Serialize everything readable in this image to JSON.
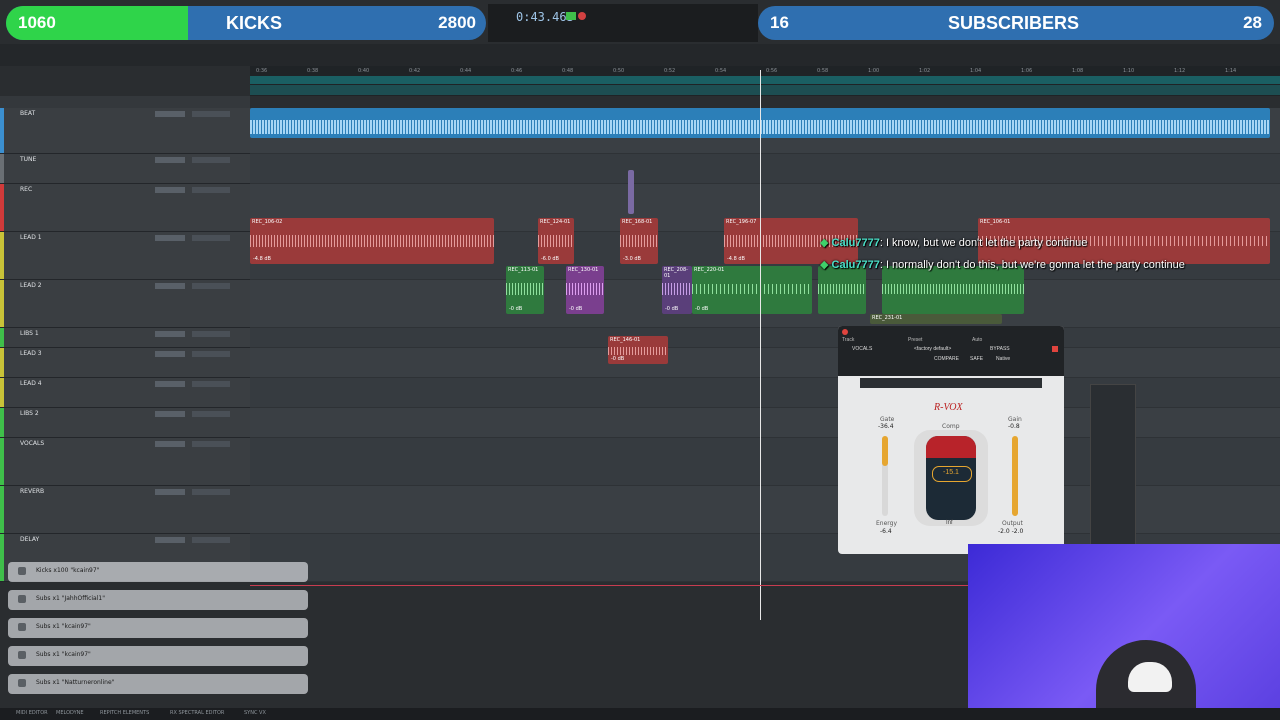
{
  "overlay": {
    "left_count": "1060",
    "left_label": "KICKS",
    "left_goal": "2800",
    "left_progress": 0.38,
    "right_count": "16",
    "right_label": "SUBSCRIBERS",
    "right_goal": "28",
    "right_progress": 0.0
  },
  "transport": {
    "counter": "0:43.463"
  },
  "tracks": [
    {
      "name": "BEAT",
      "color": "#3b8fd0"
    },
    {
      "name": "TUNE",
      "color": "#6a6f74"
    },
    {
      "name": "REC",
      "color": "#d03a3a"
    },
    {
      "name": "LEAD 1",
      "color": "#c8c238"
    },
    {
      "name": "LEAD 2",
      "color": "#c8c238"
    },
    {
      "name": "LIBS 1",
      "color": "#3fbf4a"
    },
    {
      "name": "LEAD 3",
      "color": "#c8c238"
    },
    {
      "name": "LEAD 4",
      "color": "#c8c238"
    },
    {
      "name": "LIBS 2",
      "color": "#3fbf4a"
    },
    {
      "name": "VOCALS",
      "color": "#3fbf4a"
    },
    {
      "name": "REVERB",
      "color": "#3fbf4a"
    },
    {
      "name": "DELAY",
      "color": "#3fbf4a"
    }
  ],
  "clips": {
    "lead1": [
      {
        "name": "REC_106-02",
        "db": "-4.8 dB"
      },
      {
        "name": "REC_124-01",
        "db": "-6.0 dB"
      },
      {
        "name": "REC_168-01",
        "db": "-3.0 dB"
      },
      {
        "name": "REC_196-07",
        "db": "-4.8 dB"
      },
      {
        "name": "REC_106-01",
        "db": ""
      }
    ],
    "lead2": [
      {
        "name": "REC_113-01",
        "db": "-0 dB"
      },
      {
        "name": "REC_130-01",
        "db": "-0 dB"
      },
      {
        "name": "REC_208-01",
        "db": "-0 dB"
      },
      {
        "name": "REC_220-01",
        "db": "-0 dB"
      },
      {
        "name": "REC_231-01",
        "db": ""
      }
    ],
    "lead3": [
      {
        "name": "REC_146-01",
        "db": "-0 dB"
      }
    ]
  },
  "chat": [
    {
      "user": "Calu7777",
      "text": ": I know, but we don't let the party continue"
    },
    {
      "user": "Calu7777",
      "text": ": I normally don't do this, but we're gonna let the party continue"
    }
  ],
  "plugin": {
    "title": "R-VOX",
    "gate_label": "Gate",
    "gate_value": "-36.4",
    "gain_label": "Gain",
    "gain_value": "-0.8",
    "comp_label": "Comp",
    "comp_value": "-15.1",
    "inf_label": "Inf",
    "energy_label": "Energy",
    "energy_value": "-6.4",
    "output_label": "Output",
    "output_values": "-2.0  -2.0",
    "track_label": "Track",
    "preset_label": "Preset",
    "auto_label": "Auto",
    "track_name": "VOCALS",
    "preset_name": "<factory default>",
    "bypass": "BYPASS",
    "compare": "COMPARE",
    "safe": "SAFE",
    "native": "Native"
  },
  "notifications": [
    "Kicks x100 \"kcain97\"",
    "Subs x1 \"JahhOfficial1\"",
    "Subs x1 \"kcain97\"",
    "Subs x1 \"kcain97\"",
    "Subs x1 \"Natturneronline\""
  ],
  "bottom_bar": [
    "MIDI EDITOR",
    "MELODYNE",
    "REPITCH ELEMENTS",
    "RX SPECTRAL EDITOR",
    "SYNC VX"
  ],
  "ruler_ticks": [
    "0:36",
    "0:38",
    "0:40",
    "0:42",
    "0:44",
    "0:46",
    "0:48",
    "0:50",
    "0:52",
    "0:54",
    "0:56",
    "0:58",
    "1:00",
    "1:02",
    "1:04",
    "1:06",
    "1:08",
    "1:10",
    "1:12",
    "1:14"
  ]
}
